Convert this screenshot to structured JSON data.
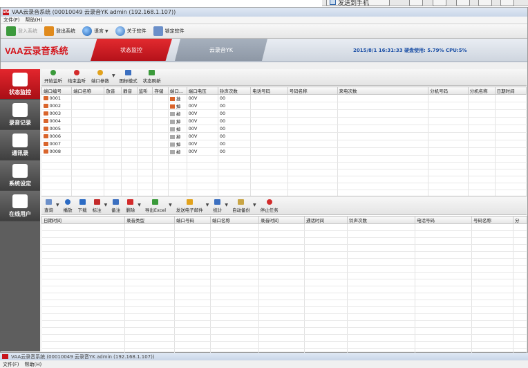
{
  "external_bar": {
    "item_label": "发送到手机"
  },
  "window": {
    "logo": "VAA",
    "title": "VAA云录音系统 (00010049 云录音YK admin (192.168.1.107))"
  },
  "menu": [
    "文件(F)",
    "帮助(H)"
  ],
  "toolbar": {
    "login": "登入系统",
    "logout": "登出系统",
    "language": "语言",
    "about": "关于软件",
    "lock": "锁定软件"
  },
  "header": {
    "brand": "VAA云录音系统",
    "tab_active": "状态监控",
    "tab_second": "云录音YK",
    "status": "2015/8/1 16:31:33  硬盘使用: 5.79% CPU:5%"
  },
  "sidebar": [
    {
      "label": "状态监控",
      "icon": "monitor-icon"
    },
    {
      "label": "录音记录",
      "icon": "tape-icon"
    },
    {
      "label": "通讯录",
      "icon": "contacts-icon"
    },
    {
      "label": "系统设定",
      "icon": "wrench-icon"
    },
    {
      "label": "在线用户",
      "icon": "users-icon"
    }
  ],
  "port_toolbar": [
    "开始监听",
    "结束监听",
    "端口参数",
    "图标模式",
    "状态刷新"
  ],
  "port_table": {
    "columns": [
      "端口编号",
      "端口名称",
      "放音",
      "静音",
      "监听",
      "存储",
      "端口...",
      "端口电压",
      "铃声次数",
      "电话号码",
      "号码名称",
      "来电次数",
      "分机号码",
      "分机名称",
      "日期时间"
    ],
    "rows": [
      {
        "id": "0001",
        "state": "挂",
        "voltage": "00V",
        "rings": "00",
        "on": true
      },
      {
        "id": "0002",
        "state": "掉",
        "voltage": "00V",
        "rings": "00",
        "on": true
      },
      {
        "id": "0003",
        "state": "掉",
        "voltage": "00V",
        "rings": "00",
        "on": false
      },
      {
        "id": "0004",
        "state": "掉",
        "voltage": "00V",
        "rings": "00",
        "on": false
      },
      {
        "id": "0005",
        "state": "掉",
        "voltage": "00V",
        "rings": "00",
        "on": false
      },
      {
        "id": "0006",
        "state": "掉",
        "voltage": "00V",
        "rings": "00",
        "on": false
      },
      {
        "id": "0007",
        "state": "掉",
        "voltage": "00V",
        "rings": "00",
        "on": false
      },
      {
        "id": "0008",
        "state": "掉",
        "voltage": "00V",
        "rings": "00",
        "on": false
      }
    ]
  },
  "record_toolbar": [
    "查询",
    "播放",
    "下载",
    "标注",
    "备注",
    "删除",
    "导出Excel",
    "发送电子邮件",
    "统计",
    "自动备份",
    "停止任务"
  ],
  "record_table": {
    "columns": [
      "日期时间",
      "录音类型",
      "端口号码",
      "端口名称",
      "录音时间",
      "通话时间",
      "铃声次数",
      "电话号码",
      "号码名称",
      "分"
    ]
  },
  "bottom_window": {
    "title": "VAA云录音系统 (00010049 云录音YK admin (192.168.1.107))",
    "menu": [
      "文件(F)",
      "帮助(H)"
    ]
  },
  "colors": {
    "accent": "#d4141b",
    "status_text": "#1c50a6",
    "sidebar_bg": "#5e5e5e"
  }
}
